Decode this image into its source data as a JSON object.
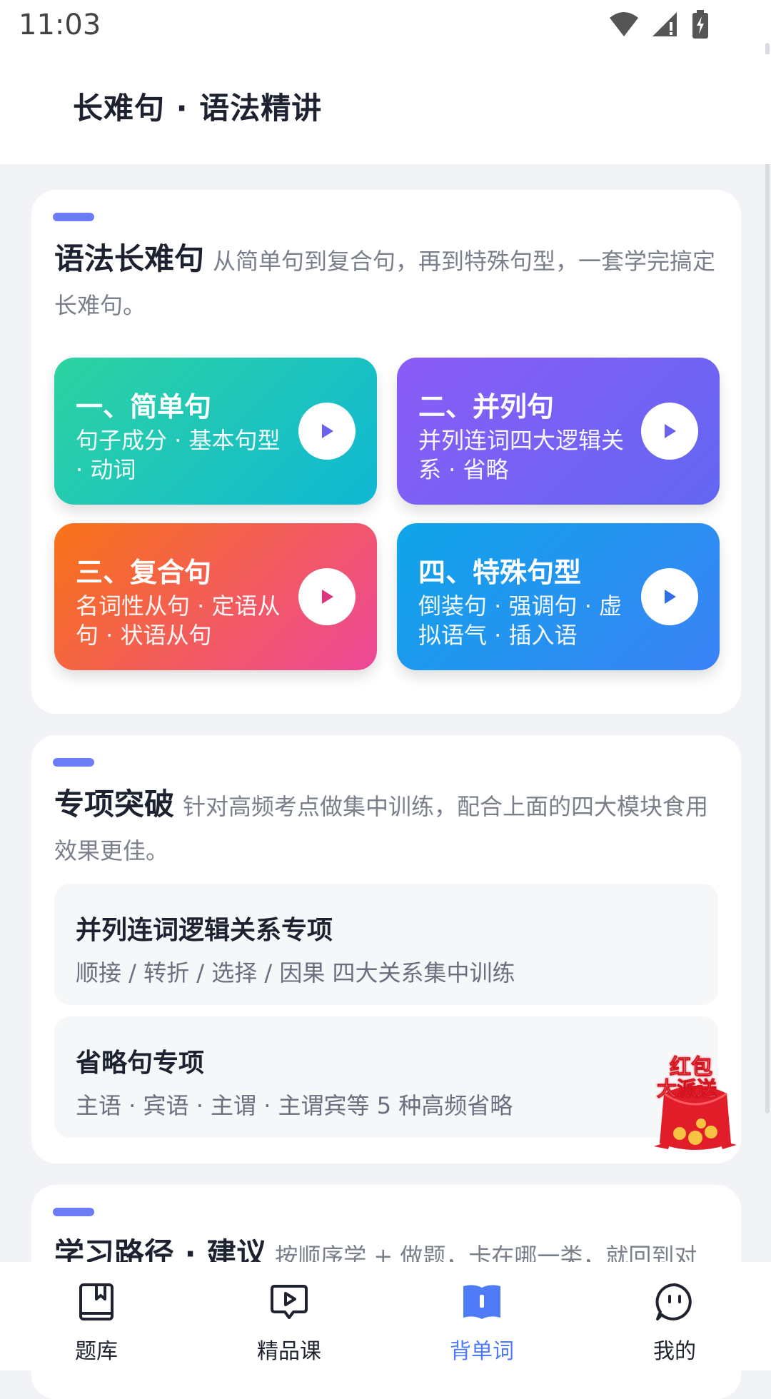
{
  "status_bar": {
    "time": "11:03"
  },
  "header": {
    "title": "长难句 · 语法精讲"
  },
  "grammar": {
    "heading": "语法长难句",
    "intro": "从简单句到复合句，再到特殊句型，一套学完搞定长难句。",
    "tiles": [
      {
        "title": "一、简单句",
        "subtitle": "句子成分 · 基本句型 · 动词",
        "gradient": [
          "#2dd3a0",
          "#10b8d4"
        ]
      },
      {
        "title": "二、并列句",
        "subtitle": "并列连词四大逻辑关系 · 省略",
        "gradient": [
          "#8b5cf6",
          "#6366f1"
        ]
      },
      {
        "title": "三、复合句",
        "subtitle": "名词性从句 · 定语从句 · 状语从句",
        "gradient": [
          "#f97316",
          "#ec4899"
        ]
      },
      {
        "title": "四、特殊句型",
        "subtitle": "倒装句 · 强调句 · 虚拟语气 · 插入语",
        "gradient": [
          "#0ea5e9",
          "#3b82f6"
        ]
      }
    ]
  },
  "special": {
    "heading": "专项突破",
    "intro": "针对高频考点做集中训练，配合上面的四大模块食用效果更佳。",
    "items": [
      {
        "title": "并列连词逻辑关系专项",
        "desc": "顺接 / 转折 / 选择 / 因果 四大关系集中训练"
      },
      {
        "title": "省略句专项",
        "desc": "主语 · 宾语 · 主谓 · 主谓宾等 5 种高频省略"
      }
    ]
  },
  "path": {
    "heading": "学习路径 · 建议",
    "intro": "按顺序学 + 做题，卡在哪一类，就回到对"
  },
  "promo": {
    "line1": "红包",
    "line2": "大派送"
  },
  "nav": {
    "items": [
      {
        "label": "题库"
      },
      {
        "label": "精品课"
      },
      {
        "label": "背单词"
      },
      {
        "label": "我的"
      }
    ],
    "active_index": 2
  },
  "colors": {
    "accent": "#6c7cf5",
    "nav_active": "#4f7cf6"
  }
}
